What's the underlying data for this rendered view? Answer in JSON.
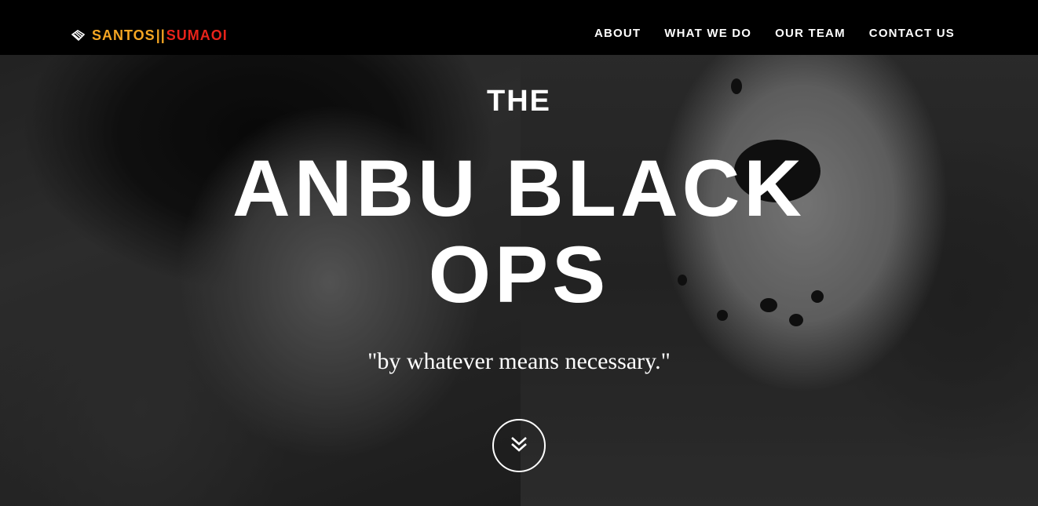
{
  "navbar": {
    "brand_part1": "SANTOS",
    "brand_separator": "||",
    "brand_part2": "SUMAOI",
    "brand_icon": "hand-pointer-icon",
    "brand_colors": {
      "part1": "#f5a623",
      "part2": "#e8231a"
    },
    "links": [
      {
        "label": "ABOUT"
      },
      {
        "label": "WHAT WE DO"
      },
      {
        "label": "OUR TEAM"
      },
      {
        "label": "CONTACT US"
      }
    ]
  },
  "intro": {
    "lead": "THE",
    "heading_line1": "ANBU BLACK",
    "heading_line2": "OPS",
    "tagline": "\"by whatever means necessary.\"",
    "scroll_icon": "double-chevron-down-icon"
  }
}
